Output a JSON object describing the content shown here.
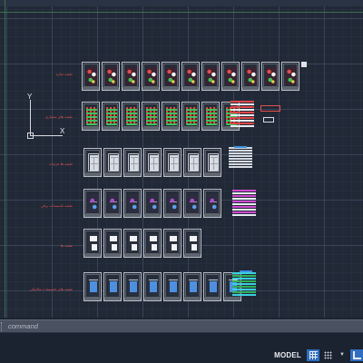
{
  "drawing": {
    "ucs": {
      "x_label": "X",
      "y_label": "Y"
    },
    "row_labels": [
      "نقشه سازه",
      "نقشه های معماری",
      "نقشه ها جزئیات",
      "نقشه تاسیسات برقی",
      "نقشه ها",
      "نقشه های تاسیسات مکانیکی"
    ],
    "rows": [
      {
        "style": "colorful",
        "count": 11
      },
      {
        "style": "redgreen",
        "count": 8
      },
      {
        "style": "grey",
        "count": 7
      },
      {
        "style": "purple",
        "count": 7
      },
      {
        "style": "white",
        "count": 6
      },
      {
        "style": "blue",
        "count": 8
      }
    ],
    "accent_colors": {
      "red": "#e05050",
      "green": "#43c05a",
      "magenta": "#d04ad0",
      "blue": "#3a8fe0"
    }
  },
  "command_line": {
    "placeholder": "command",
    "value": ""
  },
  "status_bar": {
    "model_label": "MODEL",
    "grid_icon": "grid-icon",
    "snap_icon": "snap-dots-icon",
    "ortho_icon": "ortho-icon"
  }
}
